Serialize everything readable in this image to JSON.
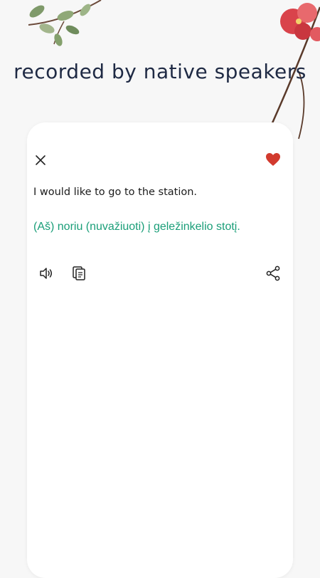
{
  "headline": "recorded by native speakers",
  "phrase": {
    "english": "I would like to go to the station.",
    "translation": "(Aš) noriu (nuvažiuoti) į geležinkelio stotį."
  },
  "icons": {
    "close": "close-icon",
    "favorite": "heart-icon",
    "audio": "speaker-icon",
    "copy": "copy-icon",
    "share": "share-icon"
  },
  "colors": {
    "background": "#f7f7f7",
    "card": "#ffffff",
    "headline": "#1f2a44",
    "translation": "#1a9e78",
    "heart": "#d23a2e"
  }
}
